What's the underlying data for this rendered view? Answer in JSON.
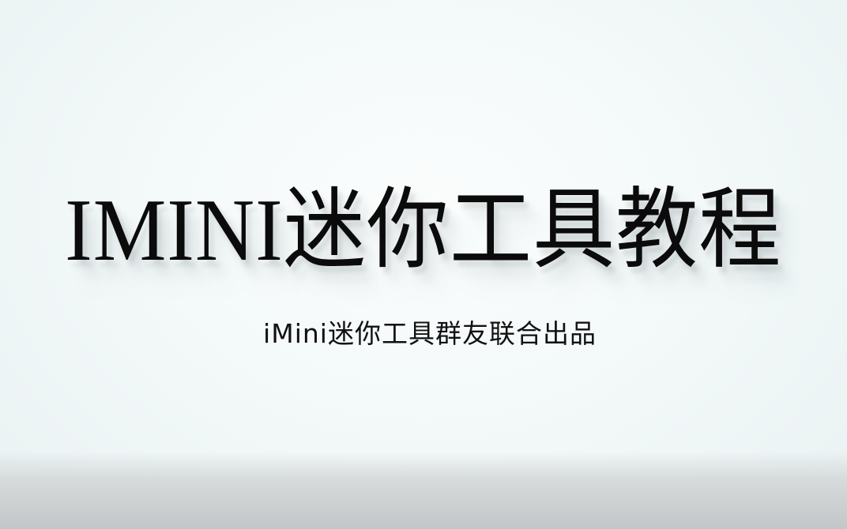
{
  "title_card": {
    "title": "IMINI迷你工具教程",
    "subtitle": "iMini迷你工具群友联合出品"
  },
  "colors": {
    "background": "#f2f8f8",
    "text": "#0b0b0b",
    "bottom_band": "#c3c6c8"
  }
}
